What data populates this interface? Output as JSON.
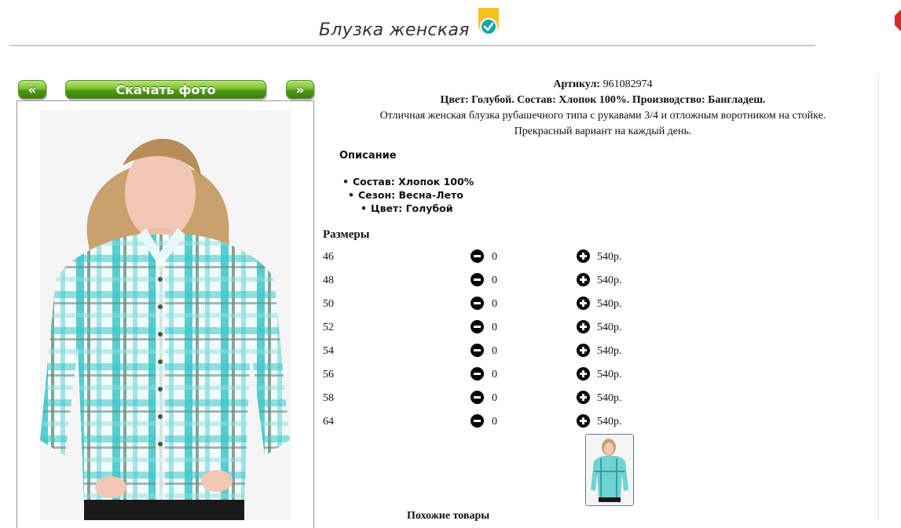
{
  "product": {
    "title": "Блузка женская",
    "sku_label": "Артикул:",
    "sku_value": "961082974",
    "spec_line": "Цвет: Голубой. Состав: Хлопок 100%. Производство: Бангладеш.",
    "desc_line1": "Отличная женская блузка рубашечного типа с рукавами 3/4 и отложным воротником на стойке.",
    "desc_line2": "Прекрасный вариант на каждый день."
  },
  "gallery": {
    "prev_label": "«",
    "download_label": "Скачать фото",
    "next_label": "»"
  },
  "description": {
    "heading": "Описание",
    "bullets": [
      "Состав: Хлопок 100%",
      "Сезон: Весна-Лето",
      "Цвет: Голубой"
    ]
  },
  "sizes": {
    "heading": "Размеры",
    "rows": [
      {
        "size": "46",
        "qty": "0",
        "price": "540р."
      },
      {
        "size": "48",
        "qty": "0",
        "price": "540р."
      },
      {
        "size": "50",
        "qty": "0",
        "price": "540р."
      },
      {
        "size": "52",
        "qty": "0",
        "price": "540р."
      },
      {
        "size": "54",
        "qty": "0",
        "price": "540р."
      },
      {
        "size": "56",
        "qty": "0",
        "price": "540р."
      },
      {
        "size": "58",
        "qty": "0",
        "price": "540р."
      },
      {
        "size": "64",
        "qty": "0",
        "price": "540р."
      }
    ]
  },
  "similar": {
    "heading": "Похожие товары"
  },
  "colors": {
    "button_green": "#5aa61c",
    "badge_yellow": "#f5c21b",
    "badge_teal": "#15a5a5",
    "shirt_turquoise": "#3cc6c8"
  },
  "icons": {
    "verified": "verified-badge-icon",
    "minus": "minus-circle-icon",
    "plus": "plus-circle-icon"
  }
}
